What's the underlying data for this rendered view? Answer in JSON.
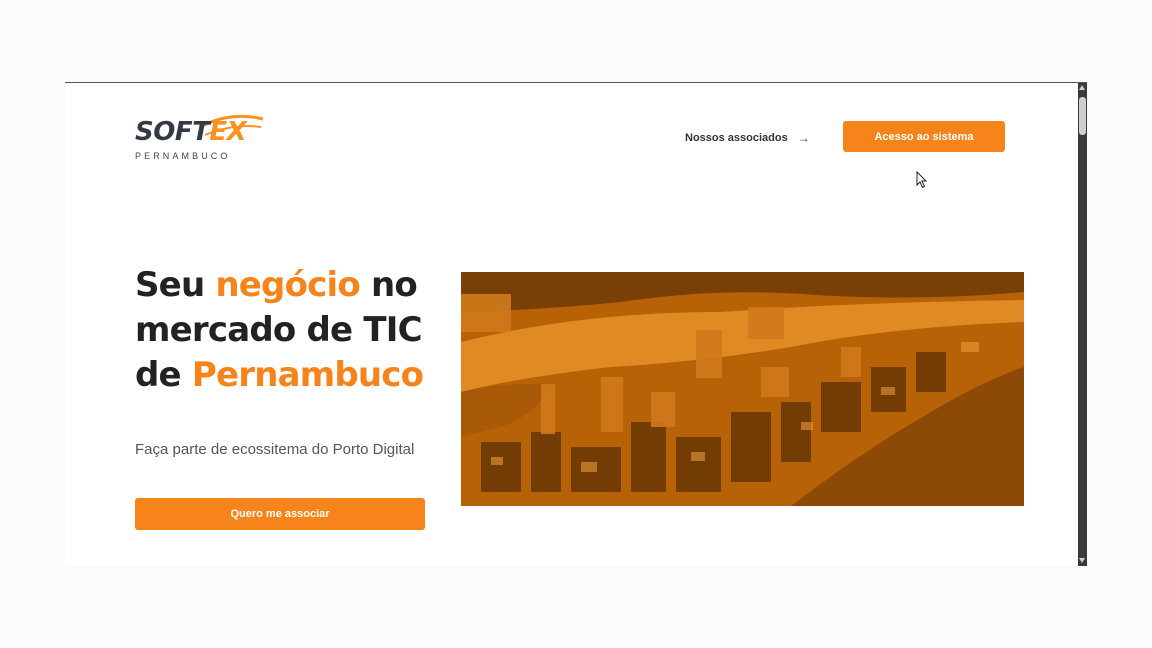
{
  "logo": {
    "brand_soft": "SOFT",
    "brand_ex": "EX",
    "subtitle": "PERNAMBUCO"
  },
  "nav": {
    "associates_label": "Nossos associados",
    "access_button": "Acesso ao sistema"
  },
  "hero": {
    "title_part1": "Seu ",
    "title_highlight1": "negócio",
    "title_part2": " no mercado de TIC de ",
    "title_highlight2": "Pernambuco",
    "subtitle": "Faça parte de ecossitema do Porto Digital",
    "cta_button": "Quero me associar"
  },
  "colors": {
    "accent": "#f7841b",
    "text_dark": "#222222"
  },
  "icons": {
    "arrow": "arrow-right-icon",
    "cursor": "mouse-pointer-icon"
  }
}
